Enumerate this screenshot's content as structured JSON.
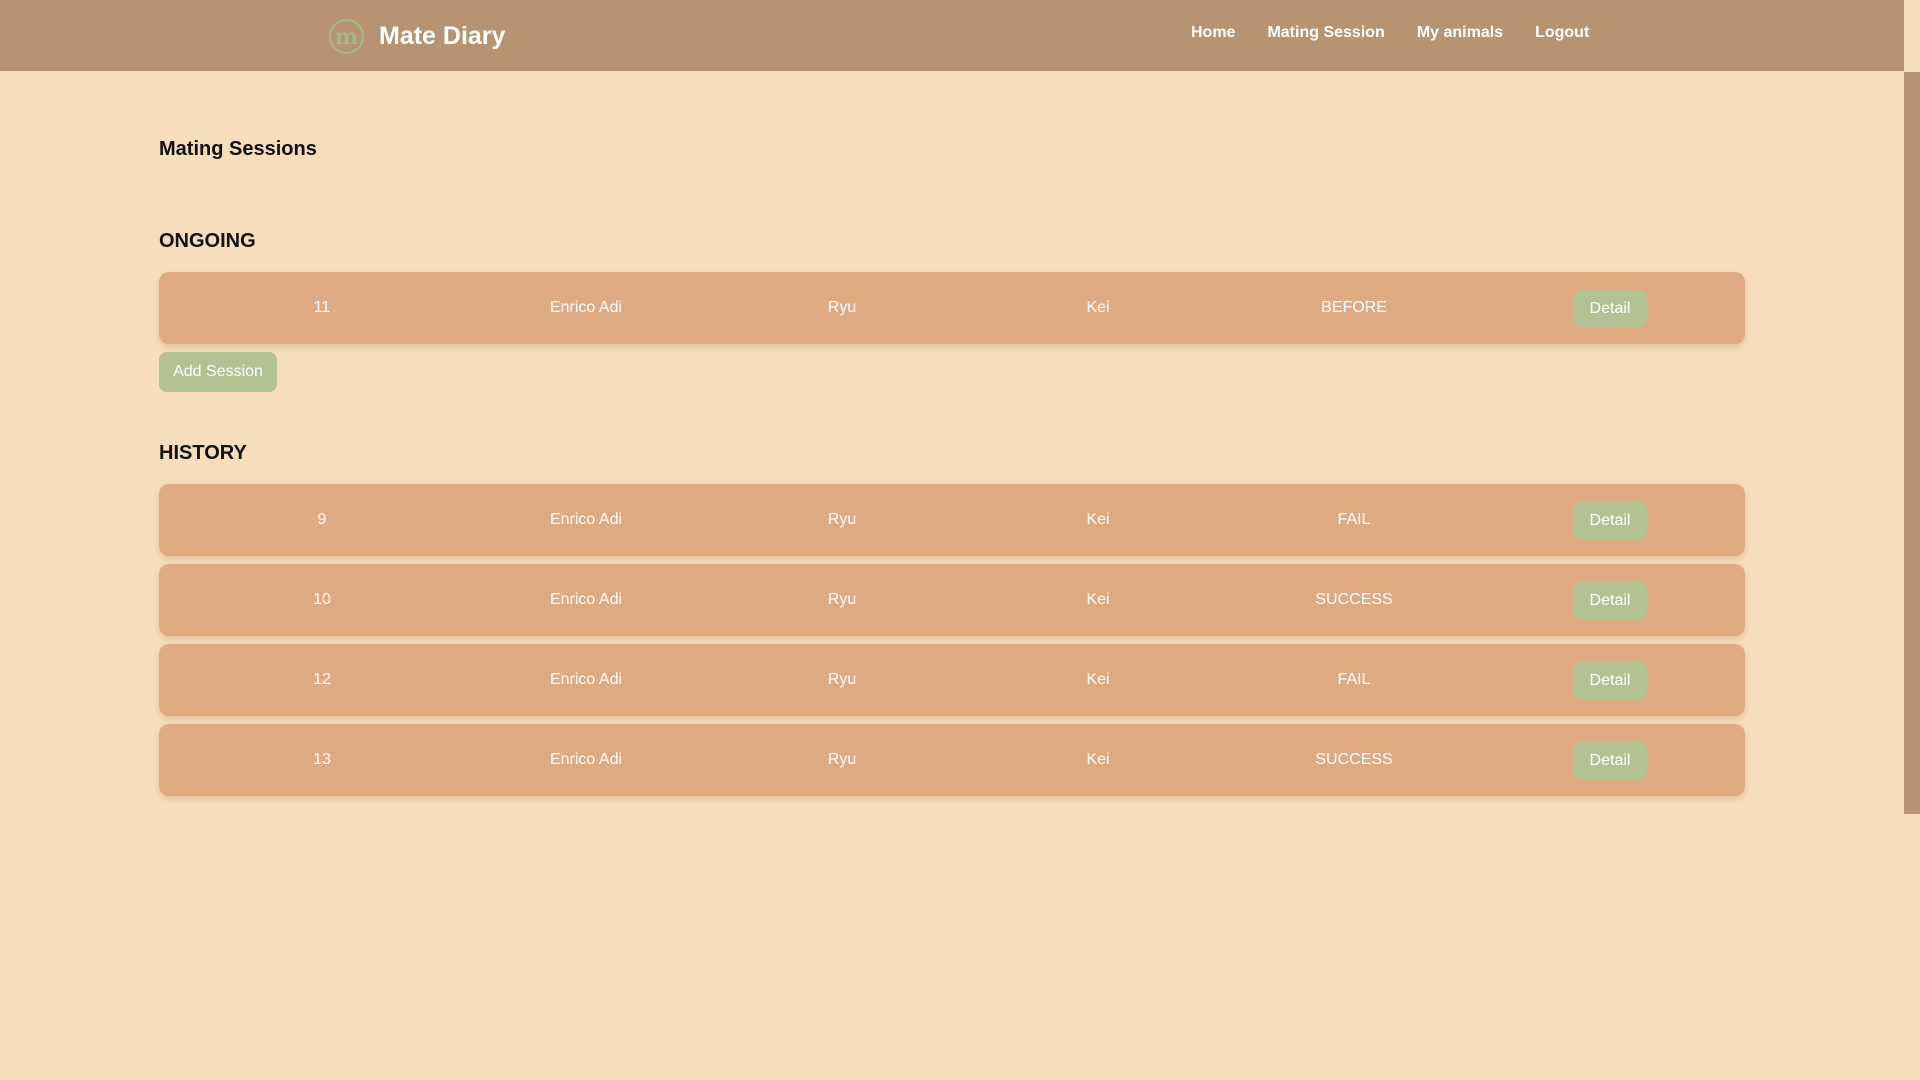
{
  "app": {
    "brand_name": "Mate Diary",
    "logo_letter": "m"
  },
  "nav": {
    "items": [
      {
        "label": "Home"
      },
      {
        "label": "Mating Session"
      },
      {
        "label": "My animals"
      },
      {
        "label": "Logout"
      }
    ]
  },
  "page": {
    "title": "Mating Sessions"
  },
  "ongoing": {
    "title": "ONGOING",
    "sessions": [
      {
        "id": "11",
        "owner": "Enrico Adi",
        "animal_1": "Ryu",
        "animal_2": "Kei",
        "status": "BEFORE",
        "action": "Detail"
      }
    ],
    "add_button": "Add Session"
  },
  "history": {
    "title": "HISTORY",
    "sessions": [
      {
        "id": "9",
        "owner": "Enrico Adi",
        "animal_1": "Ryu",
        "animal_2": "Kei",
        "status": "FAIL",
        "action": "Detail"
      },
      {
        "id": "10",
        "owner": "Enrico Adi",
        "animal_1": "Ryu",
        "animal_2": "Kei",
        "status": "SUCCESS",
        "action": "Detail"
      },
      {
        "id": "12",
        "owner": "Enrico Adi",
        "animal_1": "Ryu",
        "animal_2": "Kei",
        "status": "FAIL",
        "action": "Detail"
      },
      {
        "id": "13",
        "owner": "Enrico Adi",
        "animal_1": "Ryu",
        "animal_2": "Kei",
        "status": "SUCCESS",
        "action": "Detail"
      }
    ]
  },
  "colors": {
    "background": "#f6ddbb",
    "navbar": "#b79371",
    "row": "#dfaa82",
    "button": "#b2c293"
  }
}
